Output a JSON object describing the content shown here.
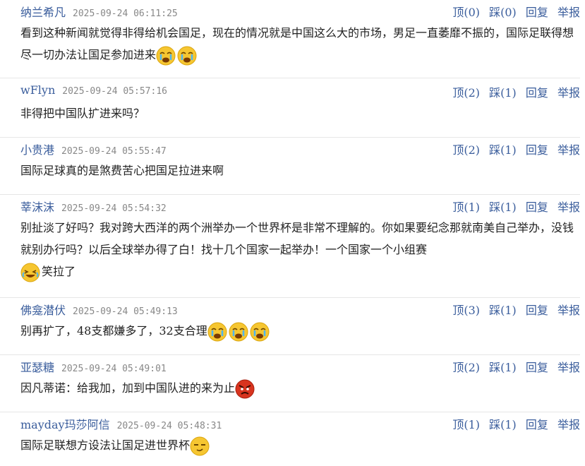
{
  "comments": [
    {
      "user": "纳兰希凡",
      "time": "2025-09-24 06:11:25",
      "up": "顶(0)",
      "down": "踩(0)",
      "reply": "回复",
      "report": "举报",
      "text": "看到这种新闻就觉得非得给机会国足，现在的情况就是中国这么大的市场，男足一直萎靡不振的，国际足联得想尽一切办法让国足参加进来",
      "emojis": [
        "cry-emoji",
        "cry-emoji"
      ]
    },
    {
      "user": "wFlyn",
      "time": "2025-09-24 05:57:16",
      "up": "顶(2)",
      "down": "踩(1)",
      "reply": "回复",
      "report": "举报",
      "text": "非得把中国队扩进来吗？",
      "emojis": []
    },
    {
      "user": "小贵港",
      "time": "2025-09-24 05:55:47",
      "up": "顶(2)",
      "down": "踩(1)",
      "reply": "回复",
      "report": "举报",
      "text": "国际足球真的是煞费苦心把国足拉进来啊",
      "emojis": []
    },
    {
      "user": "莘沫沫",
      "time": "2025-09-24 05:54:32",
      "up": "顶(1)",
      "down": "踩(1)",
      "reply": "回复",
      "report": "举报",
      "text": "别扯淡了好吗？我对跨大西洋的两个洲举办一个世界杯是非常不理解的。你如果要纪念那就南美自己举办，没钱就别办行吗？以后全球举办得了白！找十几个国家一起举办！一个国家一个小组赛",
      "emojis": [
        "laugh-cry-emoji"
      ],
      "tail": "笑拉了"
    },
    {
      "user": "佛龛潜伏",
      "time": "2025-09-24 05:49:13",
      "up": "顶(3)",
      "down": "踩(1)",
      "reply": "回复",
      "report": "举报",
      "text": "别再扩了，48支都嫌多了，32支合理",
      "emojis": [
        "cry-emoji",
        "cry-emoji",
        "cry-emoji"
      ]
    },
    {
      "user": "亚瑟糖",
      "time": "2025-09-24 05:49:01",
      "up": "顶(2)",
      "down": "踩(1)",
      "reply": "回复",
      "report": "举报",
      "text": "因凡蒂诺：给我加，加到中国队进的来为止",
      "emojis": [
        "angry-emoji"
      ]
    },
    {
      "user": "mayday玛莎阿信",
      "time": "2025-09-24 05:48:31",
      "up": "顶(1)",
      "down": "踩(1)",
      "reply": "回复",
      "report": "举报",
      "text": "国际足联想方设法让国足进世界杯",
      "emojis": [
        "smug-emoji"
      ]
    }
  ]
}
